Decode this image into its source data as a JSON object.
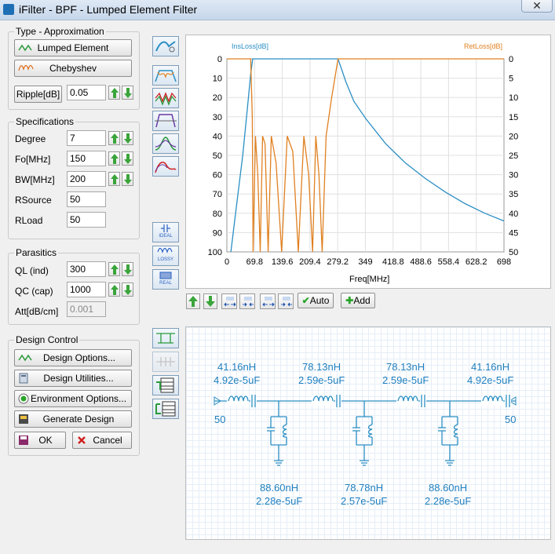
{
  "window": {
    "title": "iFilter - BPF - Lumped Element Filter",
    "close": "✕"
  },
  "type_group": {
    "title": "Type - Approximation",
    "lumped_label": "Lumped Element",
    "chebyshev_label": "Chebyshev",
    "ripple_label": "Ripple[dB]",
    "ripple_value": "0.05"
  },
  "spec_group": {
    "title": "Specifications",
    "degree_label": "Degree",
    "degree_value": "7",
    "fo_label": "Fo[MHz]",
    "fo_value": "150",
    "bw_label": "BW[MHz]",
    "bw_value": "200",
    "rsource_label": "RSource",
    "rsource_value": "50",
    "rload_label": "RLoad",
    "rload_value": "50"
  },
  "parasitics_group": {
    "title": "Parasitics",
    "ql_label": "QL (ind)",
    "ql_value": "300",
    "qc_label": "QC (cap)",
    "qc_value": "1000",
    "att_label": "Att[dB/cm]",
    "att_value": "0.001"
  },
  "design_group": {
    "title": "Design Control",
    "design_options": "Design Options...",
    "design_utilities": "Design Utilities...",
    "environment_options": "Environment Options...",
    "generate_design": "Generate Design",
    "ok": "OK",
    "cancel": "Cancel"
  },
  "side_toolbar": {
    "ideal": "IDEAL",
    "lossy": "LOSSY",
    "real": "REAL"
  },
  "chart_toolbar": {
    "auto": "Auto",
    "add": "Add"
  },
  "chart_data": {
    "type": "line",
    "xlabel": "Freq[MHz]",
    "ylabel_left": "InsLoss[dB]",
    "ylabel_right": "RetLoss[dB]",
    "xlim": [
      0,
      698
    ],
    "ylim_left": [
      0,
      100
    ],
    "ylim_right": [
      0,
      50
    ],
    "x_ticks": [
      "0",
      "69.8",
      "139.6",
      "209.4",
      "279.2",
      "349",
      "418.8",
      "488.6",
      "558.4",
      "628.2",
      "698"
    ],
    "y_ticks_left": [
      "0",
      "10",
      "20",
      "30",
      "40",
      "50",
      "60",
      "70",
      "80",
      "90",
      "100"
    ],
    "y_ticks_right": [
      "0",
      "5",
      "10",
      "15",
      "20",
      "25",
      "30",
      "35",
      "40",
      "45",
      "50"
    ],
    "grid": true,
    "colors": {
      "insloss": "#2b8fc4",
      "retloss": "#e08020"
    },
    "series": [
      {
        "name": "InsLoss[dB]",
        "axis": "left",
        "x": [
          10,
          25,
          40,
          52,
          60,
          65,
          280,
          300,
          320,
          350,
          400,
          450,
          500,
          550,
          600,
          650,
          698
        ],
        "y": [
          100,
          75,
          50,
          25,
          8,
          0,
          0,
          12,
          22,
          31,
          44,
          54,
          62,
          69,
          75,
          80,
          84
        ]
      },
      {
        "name": "RetLoss[dB]",
        "axis": "right",
        "x": [
          0,
          60,
          64,
          66,
          72,
          78,
          84,
          90,
          96,
          104,
          112,
          124,
          138,
          152,
          166,
          180,
          194,
          206,
          216,
          224,
          232,
          240,
          250,
          264,
          280,
          300,
          400,
          500,
          600,
          698
        ],
        "y": [
          0,
          0,
          15,
          50,
          20,
          30,
          50,
          20,
          22,
          50,
          20,
          27,
          50,
          20,
          24,
          50,
          20,
          30,
          50,
          20,
          30,
          50,
          20,
          10,
          0,
          0,
          0,
          0,
          0,
          0
        ]
      }
    ]
  },
  "schematic": {
    "series": [
      {
        "l": "41.16nH",
        "c": "4.92e-5uF"
      },
      {
        "l": "78.13nH",
        "c": "2.59e-5uF"
      },
      {
        "l": "78.13nH",
        "c": "2.59e-5uF"
      },
      {
        "l": "41.16nH",
        "c": "4.92e-5uF"
      }
    ],
    "shunt": [
      {
        "l": "88.60nH",
        "c": "2.28e-5uF"
      },
      {
        "l": "78.78nH",
        "c": "2.57e-5uF"
      },
      {
        "l": "88.60nH",
        "c": "2.28e-5uF"
      }
    ],
    "source": "50",
    "load": "50"
  }
}
